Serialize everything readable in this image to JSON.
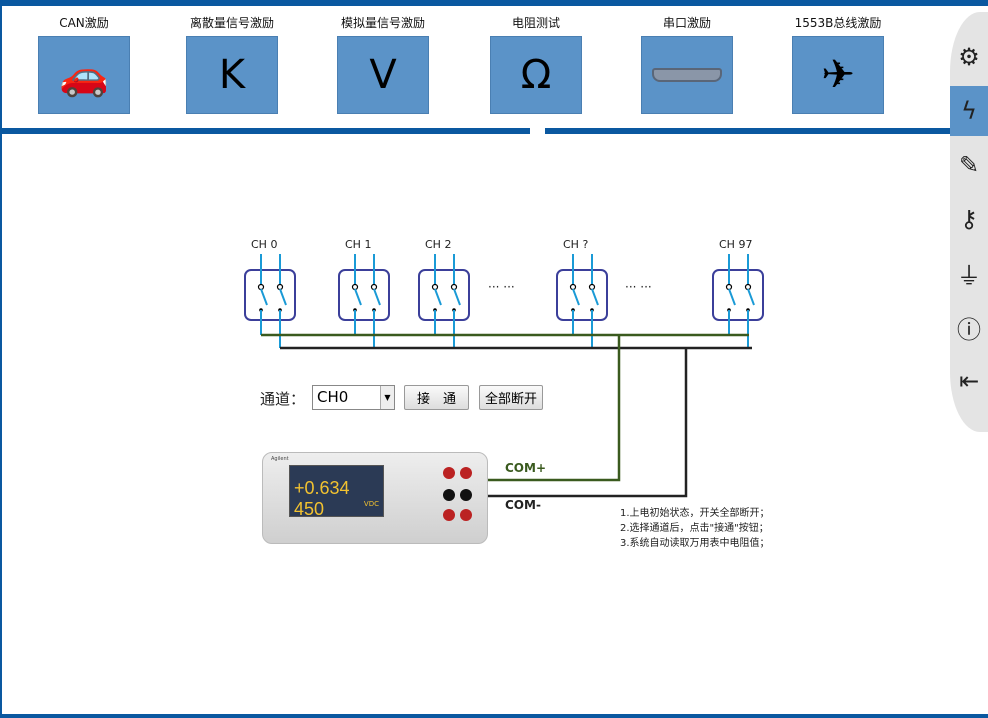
{
  "tiles": [
    {
      "label": "CAN激励",
      "icon": "car-doors-icon",
      "glyph": "🚗"
    },
    {
      "label": "离散量信号激励",
      "icon": "letter-k-icon",
      "glyph": "K"
    },
    {
      "label": "模拟量信号激励",
      "icon": "letter-v-icon",
      "glyph": "V"
    },
    {
      "label": "电阻测试",
      "icon": "omega-icon",
      "glyph": "Ω"
    },
    {
      "label": "串口激励",
      "icon": "db25-connector-icon",
      "glyph": ""
    },
    {
      "label": "1553B总线激励",
      "icon": "airplane-icon",
      "glyph": "✈"
    }
  ],
  "sidebar": [
    {
      "icon": "gear-icon",
      "glyph": "⚙"
    },
    {
      "icon": "lightning-icon",
      "glyph": "ϟ",
      "active": true
    },
    {
      "icon": "pen-icon",
      "glyph": "✎"
    },
    {
      "icon": "key-icon",
      "glyph": "⚷"
    },
    {
      "icon": "usb-icon",
      "glyph": "⏚"
    },
    {
      "icon": "info-icon",
      "glyph": "ⓘ"
    },
    {
      "icon": "logout-icon",
      "glyph": "⇤"
    }
  ],
  "channels": [
    "CH 0",
    "CH 1",
    "CH 2",
    "CH ?",
    "CH 97"
  ],
  "ellipsis": "··· ···",
  "controls": {
    "channel_label": "通道：",
    "channel_value": "CH0",
    "connect_label": "接　通",
    "disconnect_all_label": "全部断开"
  },
  "meter": {
    "reading": "+0.634 450",
    "unit": "VDC",
    "brand": "Agilent"
  },
  "com_plus": "COM+",
  "com_minus": "COM-",
  "instructions": [
    "1.上电初始状态，开关全部断开；",
    "2.选择通道后，点击\"接通\"按钮；",
    "3.系统自动读取万用表中电阻值；"
  ],
  "colors": {
    "accent": "#0a58a0",
    "tile": "#5b93c8",
    "wire_green": "#3a5a1e",
    "wire_black": "#222222",
    "switch_wire": "#1a9ad6",
    "switch_box": "#3b3f9a"
  }
}
